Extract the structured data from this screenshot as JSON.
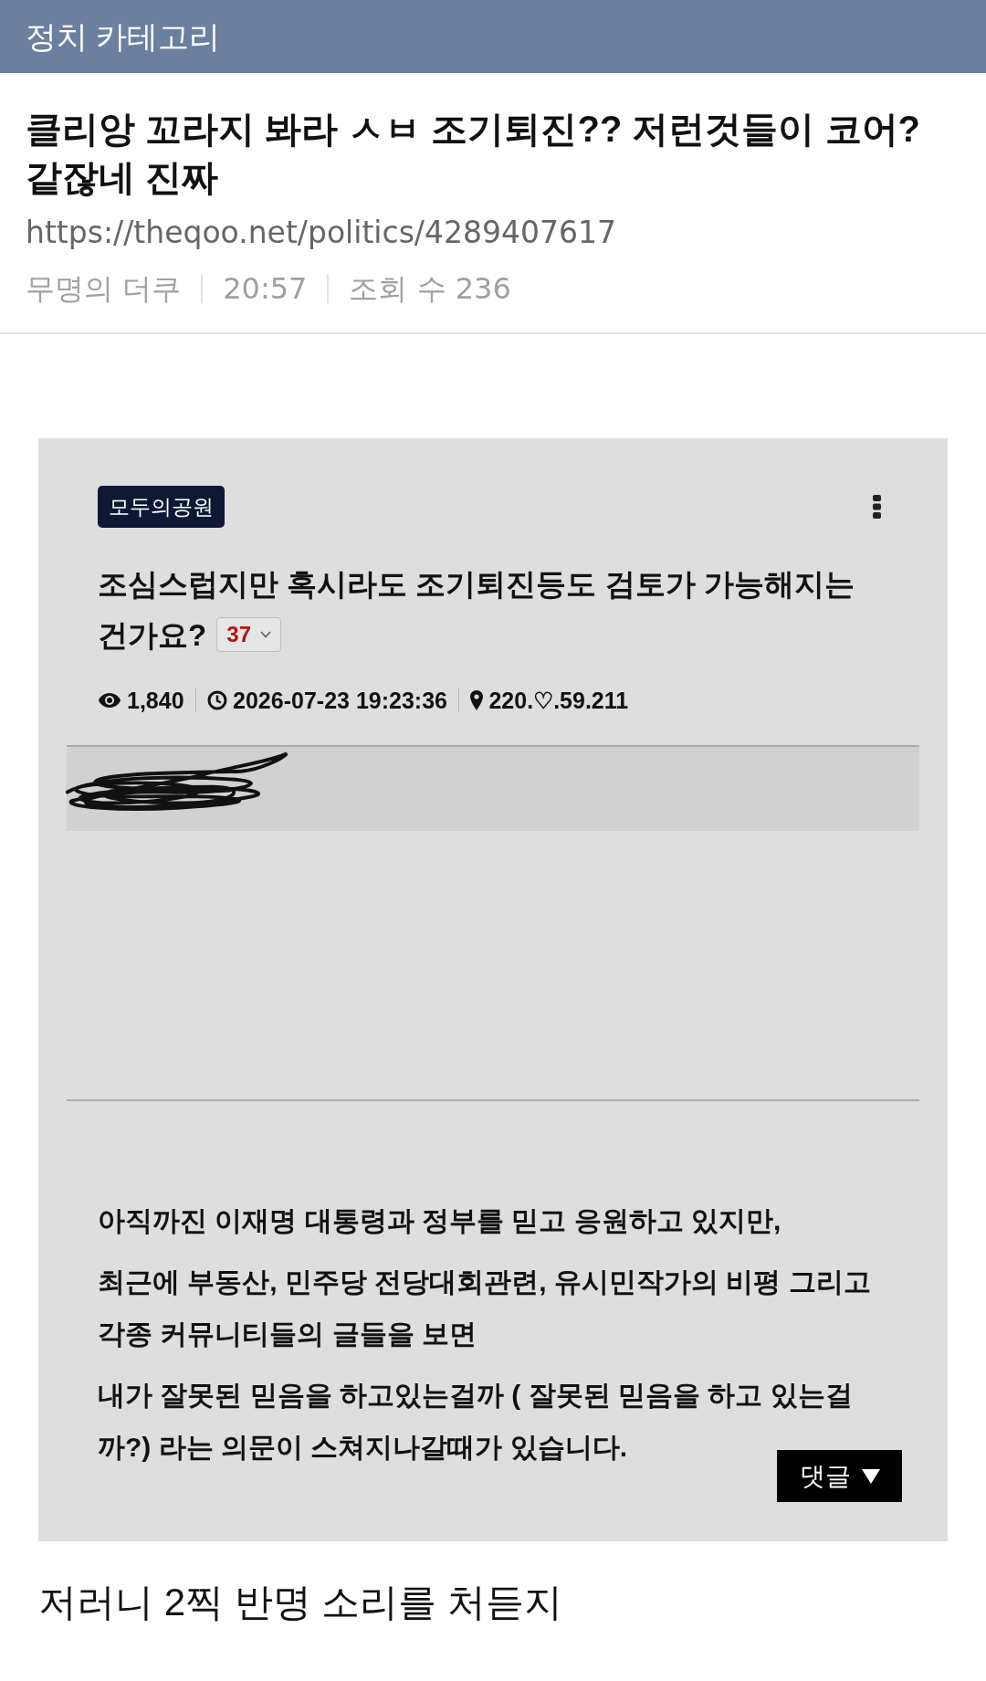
{
  "header": {
    "title": "정치 카테고리"
  },
  "post": {
    "title": "클리앙 꼬라지 봐라 ㅅㅂ 조기퇴진?? 저런것들이 코어? 같잖네 진짜",
    "url": "https://theqoo.net/politics/4289407617",
    "meta": [
      "무명의 더쿠",
      "20:57",
      "조회 수 236"
    ]
  },
  "embedded_screenshot": {
    "board_tag": "모두의공원",
    "title": "조심스럽지만 혹시라도 조기퇴진등도 검토가 가능해지는 건가요?",
    "comment_count": "37",
    "stats": [
      {
        "kind": "views",
        "text": "1,840"
      },
      {
        "kind": "time",
        "text": "2026-07-23 19:23:36"
      },
      {
        "kind": "location",
        "text": "220.♡.59.211"
      }
    ],
    "paragraphs": [
      "아직까진 이재명 대통령과 정부를 믿고 응원하고 있지만,",
      "최근에 부동산, 민주당 전당대회관련, 유시민작가의 비평 그리고 각종 커뮤니티들의 글들을 보면",
      "내가 잘못된 믿음을 하고있는걸까 ( 잘못된 믿음을 하고 있는걸까?) 라는 의문이 스쳐지나갈때가 있습니다."
    ],
    "comment_button": "댓글"
  },
  "caption": "저러니 2찍 반명 소리를 처듣지"
}
